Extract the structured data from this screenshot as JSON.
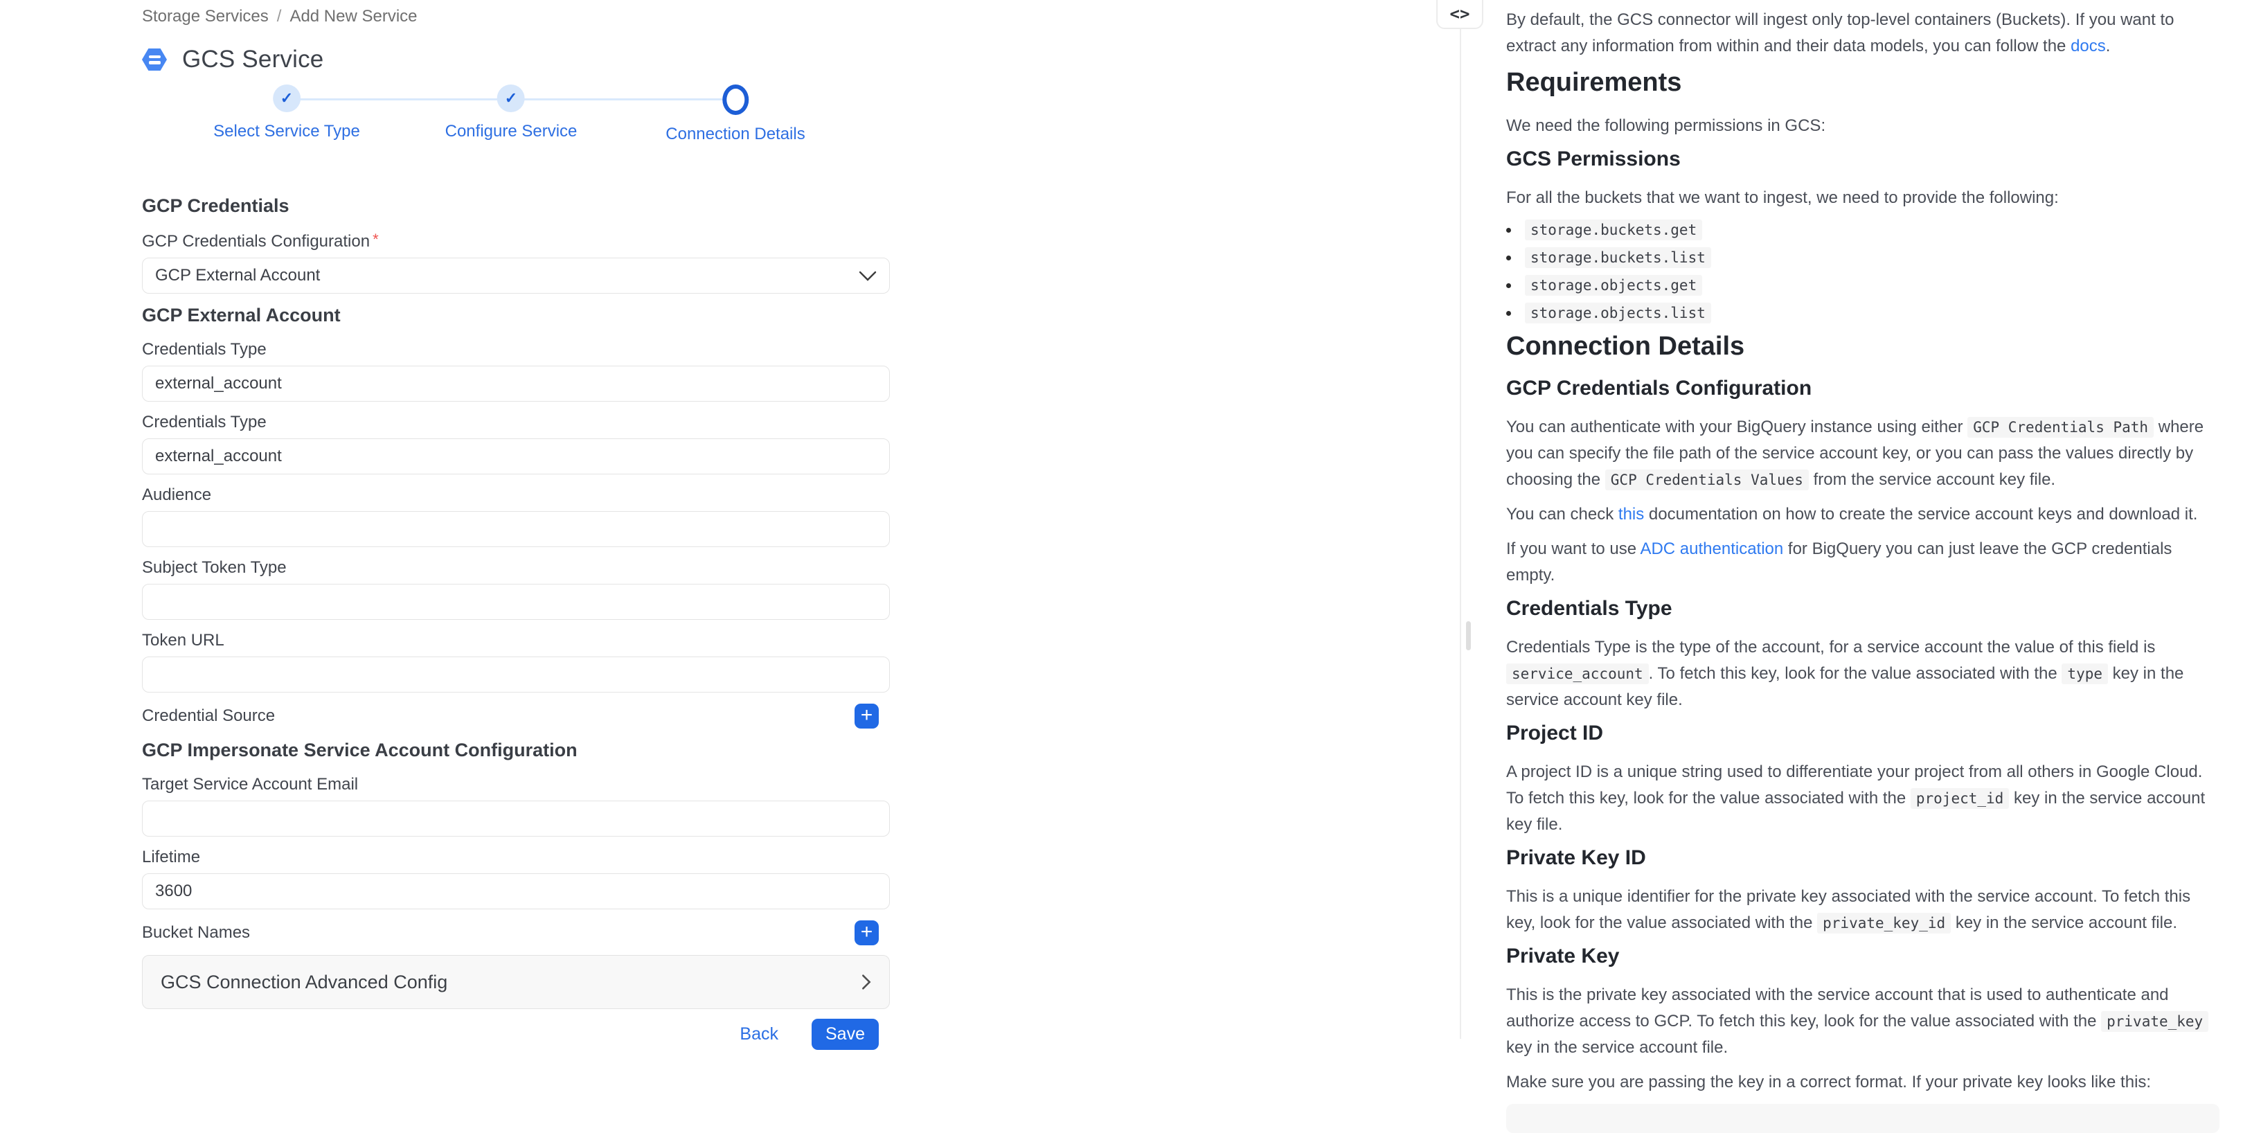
{
  "colors": {
    "accent_blue": "#2069e5",
    "link_blue": "#2f7af0",
    "stepper_blue": "#2e6fe2",
    "icon_blue": "#4787f2",
    "required_red": "#ef5350",
    "divider_gray": "#ededed",
    "code_bg": "#f5f5f5"
  },
  "icons": {
    "check": "✓",
    "plus": "+",
    "code_toggle": "<>"
  },
  "form": {
    "breadcrumb": {
      "items": [
        "Storage Services",
        "Add New Service"
      ],
      "separator": "/"
    },
    "title": "GCS Service",
    "steps": [
      {
        "label": "Select Service Type",
        "state": "done"
      },
      {
        "label": "Configure Service",
        "state": "done"
      },
      {
        "label": "Connection Details",
        "state": "active"
      }
    ],
    "sections": {
      "gcp_credentials": "GCP Credentials",
      "gcp_external_account": "GCP External Account",
      "gcp_impersonate": "GCP Impersonate Service Account Configuration"
    },
    "fields": {
      "credentials_configuration": {
        "label": "GCP Credentials Configuration",
        "required_marker": "*",
        "value": "GCP External Account"
      },
      "credentials_type_1": {
        "label": "Credentials Type",
        "value": "external_account"
      },
      "credentials_type_2": {
        "label": "Credentials Type",
        "value": "external_account"
      },
      "audience": {
        "label": "Audience",
        "value": ""
      },
      "subject_token_type": {
        "label": "Subject Token Type",
        "value": ""
      },
      "token_url": {
        "label": "Token URL",
        "value": ""
      },
      "credential_source": {
        "label": "Credential Source"
      },
      "target_service_account_email": {
        "label": "Target Service Account Email",
        "value": ""
      },
      "lifetime": {
        "label": "Lifetime",
        "value": "3600"
      },
      "bucket_names": {
        "label": "Bucket Names"
      }
    },
    "advanced_config_label": "GCS Connection Advanced Config",
    "footer": {
      "back_label": "Back",
      "save_label": "Save"
    }
  },
  "docs": {
    "intro": [
      {
        "t": "text",
        "v": "By default, the GCS connector will ingest only top-level containers (Buckets). If you want to extract any information from within and their data models, you can follow the "
      },
      {
        "t": "link",
        "v": "docs"
      },
      {
        "t": "text",
        "v": "."
      }
    ],
    "requirements_title": "Requirements",
    "requirements_intro": "We need the following permissions in GCS:",
    "gcs_permissions_title": "GCS Permissions",
    "permissions_intro": "For all the buckets that we want to ingest, we need to provide the following:",
    "permissions": [
      "storage.buckets.get",
      "storage.buckets.list",
      "storage.objects.get",
      "storage.objects.list"
    ],
    "connection_details_title": "Connection Details",
    "gcp_credentials_configuration": {
      "title": "GCP Credentials Configuration",
      "p1": [
        {
          "t": "text",
          "v": "You can authenticate with your BigQuery instance using either "
        },
        {
          "t": "code",
          "v": "GCP Credentials Path"
        },
        {
          "t": "text",
          "v": " where you can specify the file path of the service account key, or you can pass the values directly by choosing the "
        },
        {
          "t": "code",
          "v": "GCP Credentials Values"
        },
        {
          "t": "text",
          "v": " from the service account key file."
        }
      ],
      "p2": [
        {
          "t": "text",
          "v": "You can check "
        },
        {
          "t": "link",
          "v": "this"
        },
        {
          "t": "text",
          "v": " documentation on how to create the service account keys and download it."
        }
      ],
      "p3": [
        {
          "t": "text",
          "v": "If you want to use "
        },
        {
          "t": "link",
          "v": "ADC authentication"
        },
        {
          "t": "text",
          "v": " for BigQuery you can just leave the GCP credentials empty."
        }
      ]
    },
    "credentials_type": {
      "title": "Credentials Type",
      "p1": [
        {
          "t": "text",
          "v": "Credentials Type is the type of the account, for a service account the value of this field is "
        },
        {
          "t": "code",
          "v": "service_account"
        },
        {
          "t": "text",
          "v": ". To fetch this key, look for the value associated with the "
        },
        {
          "t": "code",
          "v": "type"
        },
        {
          "t": "text",
          "v": " key in the service account key file."
        }
      ]
    },
    "project_id": {
      "title": "Project ID",
      "p1": [
        {
          "t": "text",
          "v": "A project ID is a unique string used to differentiate your project from all others in Google Cloud. To fetch this key, look for the value associated with the "
        },
        {
          "t": "code",
          "v": "project_id"
        },
        {
          "t": "text",
          "v": " key in the service account key file."
        }
      ]
    },
    "private_key_id": {
      "title": "Private Key ID",
      "p1": [
        {
          "t": "text",
          "v": "This is a unique identifier for the private key associated with the service account. To fetch this key, look for the value associated with the "
        },
        {
          "t": "code",
          "v": "private_key_id"
        },
        {
          "t": "text",
          "v": " key in the service account file."
        }
      ]
    },
    "private_key": {
      "title": "Private Key",
      "p1": [
        {
          "t": "text",
          "v": "This is the private key associated with the service account that is used to authenticate and authorize access to GCP. To fetch this key, look for the value associated with the "
        },
        {
          "t": "code",
          "v": "private_key"
        },
        {
          "t": "text",
          "v": " key in the service account file."
        }
      ],
      "p2": "Make sure you are passing the key in a correct format. If your private key looks like this:"
    }
  }
}
